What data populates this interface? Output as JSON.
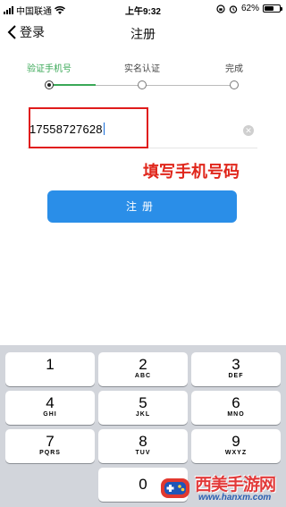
{
  "status_bar": {
    "carrier": "中国联通",
    "time": "上午9:32",
    "battery_percent": "62%",
    "battery_level": 0.62
  },
  "nav": {
    "back_label": "登录",
    "title": "注册"
  },
  "steps": [
    {
      "label": "验证手机号",
      "active": true
    },
    {
      "label": "实名认证",
      "active": false
    },
    {
      "label": "完成",
      "active": false
    }
  ],
  "phone_field": {
    "value": "17558727628",
    "clear_icon": "✕"
  },
  "annotation": "填写手机号码",
  "register_button": "注册",
  "keypad": {
    "keys": [
      {
        "digit": "1",
        "letters": ""
      },
      {
        "digit": "2",
        "letters": "ABC"
      },
      {
        "digit": "3",
        "letters": "DEF"
      },
      {
        "digit": "4",
        "letters": "GHI"
      },
      {
        "digit": "5",
        "letters": "JKL"
      },
      {
        "digit": "6",
        "letters": "MNO"
      },
      {
        "digit": "7",
        "letters": "PQRS"
      },
      {
        "digit": "8",
        "letters": "TUV"
      },
      {
        "digit": "9",
        "letters": "WXYZ"
      },
      {
        "digit": "0",
        "letters": ""
      }
    ]
  },
  "watermark": {
    "title": "西美手游网",
    "url": "www.hanxm.com"
  },
  "colors": {
    "accent_green": "#3aa857",
    "button_blue": "#2a8ee8",
    "annotation_red": "#e0261b"
  }
}
